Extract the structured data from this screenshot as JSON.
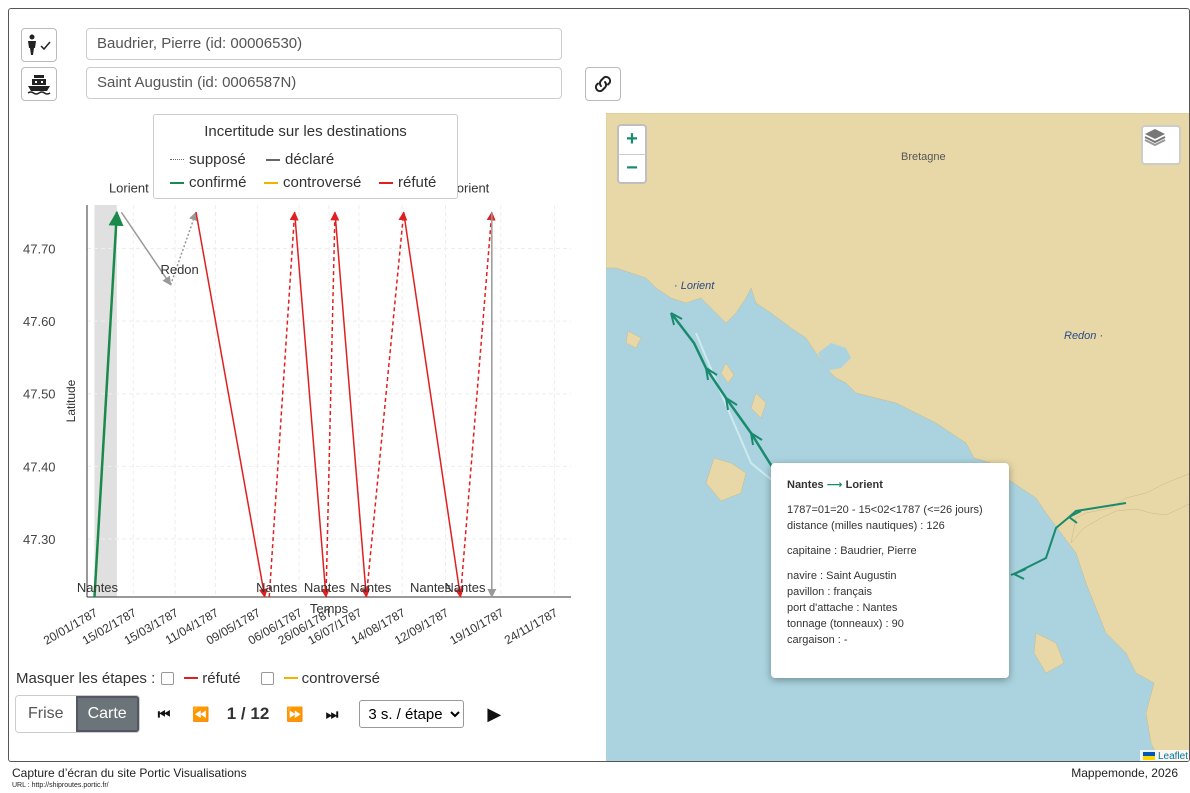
{
  "captain_field": "Baudrier, Pierre (id: 00006530)",
  "ship_field": "Saint Augustin (id: 0006587N)",
  "icons": {
    "captain": "person-check-icon",
    "ship": "ship-icon",
    "link": "link-icon",
    "layers": "layers-icon"
  },
  "legend": {
    "title": "Incertitude sur les destinations",
    "items": [
      {
        "label": "supposé",
        "style": "dotted",
        "color": "#666666"
      },
      {
        "label": "déclaré",
        "style": "solid",
        "color": "#666666"
      },
      {
        "label": "confirmé",
        "style": "solid",
        "color": "#1a8a4a"
      },
      {
        "label": "controversé",
        "style": "solid",
        "color": "#f0b400"
      },
      {
        "label": "réfuté",
        "style": "solid",
        "color": "#e02020"
      }
    ]
  },
  "chart_data": {
    "type": "line",
    "xlabel": "Temps",
    "ylabel": "Latitude",
    "x_ticks": [
      "20/01/1787",
      "15/02/1787",
      "15/03/1787",
      "11/04/1787",
      "09/05/1787",
      "06/06/1787",
      "26/06/1787",
      "16/07/1787",
      "14/08/1787",
      "12/09/1787",
      "19/10/1787",
      "24/11/1787"
    ],
    "y_ticks": [
      "47.70",
      "47.60",
      "47.50",
      "47.40",
      "47.30"
    ],
    "ylim": [
      47.22,
      47.76
    ],
    "places": {
      "Lorient": 47.75,
      "Redon": 47.65,
      "Nantes": 47.22
    },
    "top_labels": [
      {
        "label": "Lorient",
        "date": "1787-02-12"
      },
      {
        "label": "Lorient",
        "date": "1787-04-04"
      },
      {
        "label": "Lorient",
        "date": "1787-06-12"
      },
      {
        "label": "Lorient",
        "date": "1787-07-07"
      },
      {
        "label": "Lorient",
        "date": "1787-08-24"
      },
      {
        "label": "Lorient",
        "date": "1787-09-28"
      }
    ],
    "middle_labels": [
      {
        "label": "Redon",
        "date": "1787-03-18"
      }
    ],
    "bottom_labels": [
      {
        "label": "Nantes",
        "date": "1787-01-22"
      },
      {
        "label": "Nantes",
        "date": "1787-05-22"
      },
      {
        "label": "Nantes",
        "date": "1787-06-23"
      },
      {
        "label": "Nantes",
        "date": "1787-07-24"
      },
      {
        "label": "Nantes",
        "date": "1787-09-02"
      },
      {
        "label": "Nantes",
        "date": "1787-09-25"
      }
    ],
    "highlight": {
      "from": "1787-01-20",
      "to": "1787-02-04"
    },
    "segments": [
      {
        "from": [
          "1787-01-20",
          47.22
        ],
        "to": [
          "1787-02-04",
          47.75
        ],
        "status": "confirmé",
        "style": "solid",
        "color": "#1a8a4a"
      },
      {
        "from": [
          "1787-02-07",
          47.75
        ],
        "to": [
          "1787-03-12",
          47.65
        ],
        "status": "déclaré",
        "style": "solid",
        "color": "#999999"
      },
      {
        "from": [
          "1787-03-12",
          47.65
        ],
        "to": [
          "1787-03-29",
          47.75
        ],
        "status": "supposé",
        "style": "dotted",
        "color": "#999999"
      },
      {
        "from": [
          "1787-03-29",
          47.75
        ],
        "to": [
          "1787-05-14",
          47.22
        ],
        "status": "réfuté",
        "style": "solid",
        "color": "#e02020"
      },
      {
        "from": [
          "1787-05-17",
          47.22
        ],
        "to": [
          "1787-06-03",
          47.75
        ],
        "status": "réfuté",
        "style": "dashed",
        "color": "#e02020"
      },
      {
        "from": [
          "1787-06-03",
          47.75
        ],
        "to": [
          "1787-06-24",
          47.22
        ],
        "status": "réfuté",
        "style": "solid",
        "color": "#e02020"
      },
      {
        "from": [
          "1787-06-24",
          47.22
        ],
        "to": [
          "1787-06-30",
          47.75
        ],
        "status": "réfuté",
        "style": "dashed",
        "color": "#e02020"
      },
      {
        "from": [
          "1787-06-30",
          47.75
        ],
        "to": [
          "1787-07-21",
          47.22
        ],
        "status": "réfuté",
        "style": "solid",
        "color": "#e02020"
      },
      {
        "from": [
          "1787-07-21",
          47.22
        ],
        "to": [
          "1787-08-15",
          47.75
        ],
        "status": "réfuté",
        "style": "dashed",
        "color": "#e02020"
      },
      {
        "from": [
          "1787-08-15",
          47.75
        ],
        "to": [
          "1787-09-22",
          47.22
        ],
        "status": "réfuté",
        "style": "solid",
        "color": "#e02020"
      },
      {
        "from": [
          "1787-09-22",
          47.22
        ],
        "to": [
          "1787-10-13",
          47.75
        ],
        "status": "réfuté",
        "style": "dashed",
        "color": "#e02020"
      },
      {
        "from": [
          "1787-10-13",
          47.75
        ],
        "to": [
          "1787-10-13",
          47.22
        ],
        "status": "déclaré",
        "style": "solid",
        "color": "#999999"
      }
    ]
  },
  "mask": {
    "label": "Masquer les étapes :",
    "refute": "réfuté",
    "controverse": "controversé"
  },
  "controls": {
    "frise": "Frise",
    "carte": "Carte",
    "counter": "1 / 12",
    "speed_options": [
      "3 s. / étape"
    ],
    "speed": "3 s. / étape"
  },
  "map": {
    "zoom_in": "+",
    "zoom_out": "−",
    "places": {
      "bretagne": "Bretagne",
      "lorient": "· Lorient",
      "redon": "Redon ·"
    },
    "attribution": "Leaflet",
    "popup": {
      "route_from": "Nantes",
      "route_arrow": "⟶",
      "route_to": "Lorient",
      "dates": "1787=01=20 - 15<02<1787 (<=26 jours)",
      "distance": "distance (milles nautiques) : 126",
      "captain": "capitaine : Baudrier, Pierre",
      "ship": "navire : Saint Augustin",
      "flag": "pavillon : français",
      "port": "port d'attache : Nantes",
      "tonnage": "tonnage (tonneaux) : 90",
      "cargo": "cargaison :  -"
    }
  },
  "footer": {
    "left": "Capture d’écran du site Portic Visualisations",
    "url": "URL : http://shiproutes.portic.fr/",
    "right": "Mappemonde, 2026"
  }
}
